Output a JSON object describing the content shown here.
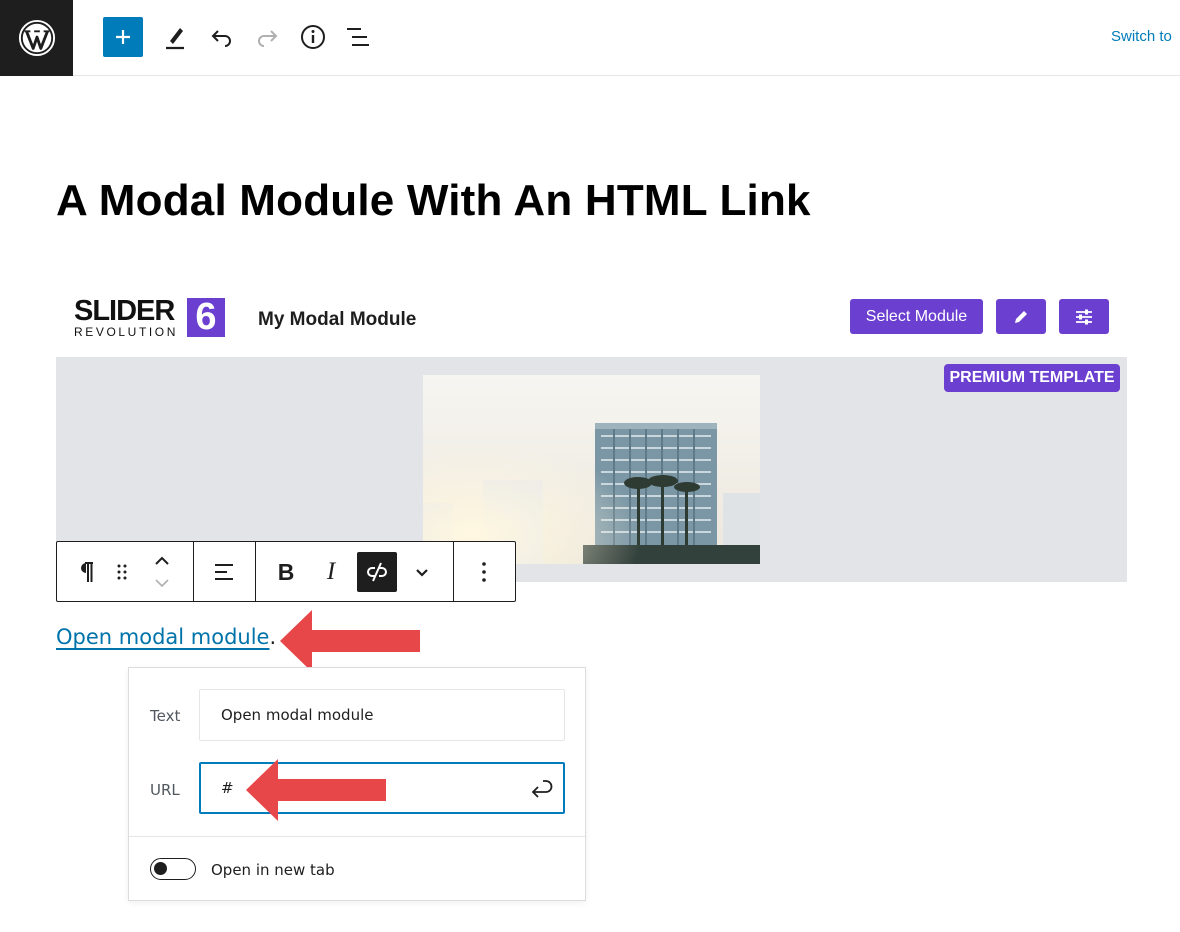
{
  "topbar": {
    "switch_label": "Switch to"
  },
  "post": {
    "title": "A Modal Module With An HTML Link"
  },
  "slider_block": {
    "logo_word": "SLIDER",
    "logo_sub": "REVOLUTION",
    "logo_version": "6",
    "module_name": "My Modal Module",
    "select_label": "Select Module",
    "badge_label": "PREMIUM TEMPLATE"
  },
  "paragraph": {
    "link_text": "Open modal module",
    "trailing": "."
  },
  "link_popover": {
    "text_label": "Text",
    "text_value": "Open modal module",
    "url_label": "URL",
    "url_value": "#",
    "new_tab_label": "Open in new tab",
    "new_tab_enabled": false
  },
  "colors": {
    "wp_dark": "#1e1e1e",
    "wp_blue": "#007cba",
    "slider_purple": "#6b3fd0",
    "annotation_red": "#e8474a"
  }
}
